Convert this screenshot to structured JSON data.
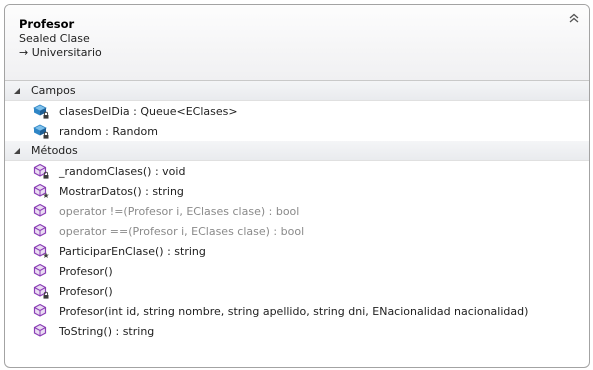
{
  "header": {
    "class_name": "Profesor",
    "class_kind": "Sealed Clase",
    "base_class": "→ Universitario"
  },
  "sections": {
    "fields": {
      "label": "Campos",
      "items": [
        {
          "label": "clasesDelDia : Queue<EClases>",
          "icon": "private-field-icon"
        },
        {
          "label": "random : Random",
          "icon": "private-field-icon"
        }
      ]
    },
    "methods": {
      "label": "Métodos",
      "items": [
        {
          "label": "_randomClases() : void",
          "icon": "private-method-icon"
        },
        {
          "label": "MostrarDatos() : string",
          "icon": "protected-method-icon"
        },
        {
          "label": "operator !=(Profesor i, EClases clase) : bool",
          "icon": "public-method-icon"
        },
        {
          "label": "operator ==(Profesor i, EClases clase) : bool",
          "icon": "public-method-icon"
        },
        {
          "label": "ParticiparEnClase() : string",
          "icon": "protected-method-icon"
        },
        {
          "label": "Profesor()",
          "icon": "public-method-icon"
        },
        {
          "label": "Profesor()",
          "icon": "private-method-icon"
        },
        {
          "label": "Profesor(int id, string nombre, string apellido, string dni, ENacionalidad nacionalidad)",
          "icon": "public-method-icon"
        },
        {
          "label": "ToString() : string",
          "icon": "public-method-icon"
        }
      ]
    }
  },
  "colors": {
    "method_icon": "#8b3fb6",
    "field_icon": "#2f86c6",
    "lock_badge": "#3c3c3c",
    "dim_text": "#8a8a8a"
  }
}
